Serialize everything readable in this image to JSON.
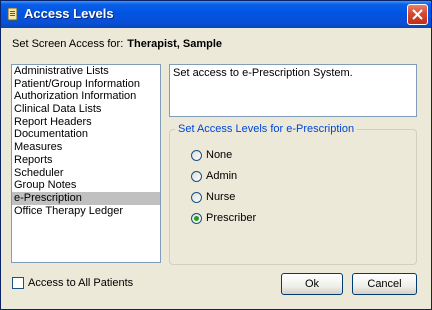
{
  "window": {
    "title": "Access Levels"
  },
  "header": {
    "label": "Set Screen Access for:",
    "who": "Therapist, Sample"
  },
  "screens": {
    "items": [
      "Administrative Lists",
      "Patient/Group Information",
      "Authorization Information",
      "Clinical Data Lists",
      "Report Headers",
      "Documentation",
      "Measures",
      "Reports",
      "Scheduler",
      "Group Notes",
      "e-Prescription",
      "Office Therapy Ledger"
    ],
    "selected_index": 10
  },
  "description": "Set access to e-Prescription System.",
  "access_group": {
    "legend": "Set Access Levels for e-Prescription",
    "options": [
      "None",
      "Admin",
      "Nurse",
      "Prescriber"
    ],
    "selected": "Prescriber"
  },
  "footer": {
    "all_patients_label": "Access to All Patients",
    "all_patients_checked": false,
    "ok_label": "Ok",
    "cancel_label": "Cancel"
  },
  "colors": {
    "title_bar": "#0054e3",
    "legend_text": "#0046d5",
    "selected_item": "#c0c0c0",
    "radio_dot": "#21a121"
  }
}
